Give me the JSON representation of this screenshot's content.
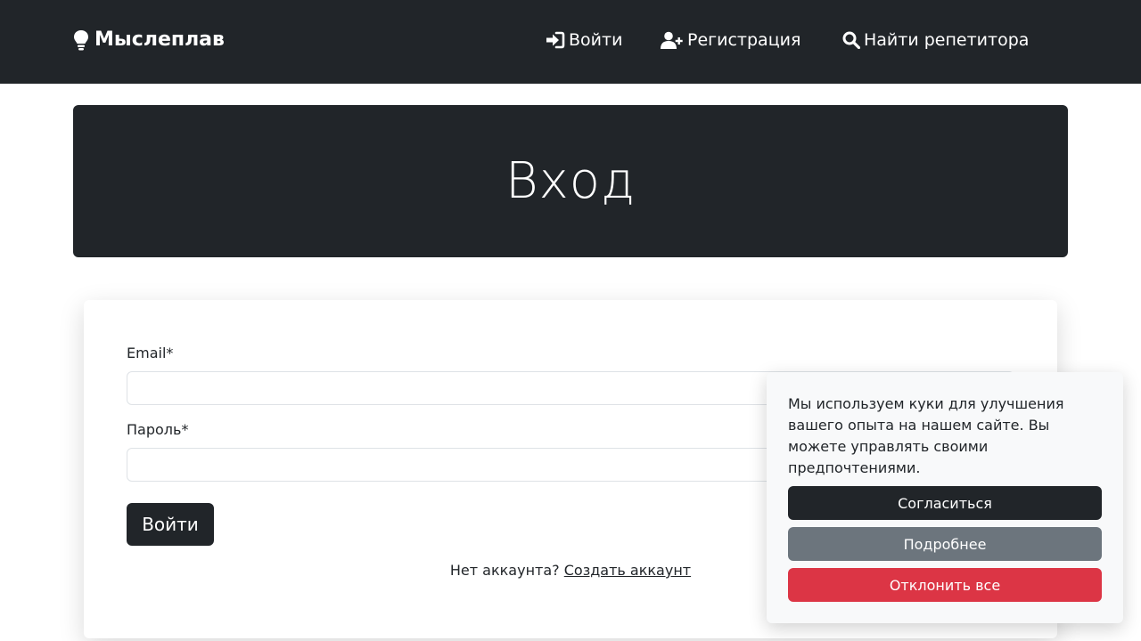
{
  "navbar": {
    "brand": "Мыслеплав",
    "brand_icon": "lightbulb-icon",
    "links": [
      {
        "label": "Войти",
        "icon": "sign-in-icon"
      },
      {
        "label": "Регистрация",
        "icon": "user-plus-icon"
      },
      {
        "label": "Найти репетитора",
        "icon": "search-icon"
      }
    ]
  },
  "hero": {
    "title": "Вход"
  },
  "login_form": {
    "email_label": "Email*",
    "email_value": "",
    "password_label": "Пароль*",
    "password_value": "",
    "submit_label": "Войти",
    "no_account_text": "Нет аккаунта?",
    "create_account_link": "Создать аккаунт"
  },
  "cookie_banner": {
    "text": "Мы используем куки для улучшения вашего опыта на нашем сайте. Вы можете управлять своими предпочтениями.",
    "accept_label": "Согласиться",
    "more_label": "Подробнее",
    "decline_label": "Отклонить все"
  },
  "colors": {
    "dark": "#212529",
    "secondary": "#6c757d",
    "danger": "#dc3545",
    "light": "#f8f9fa"
  }
}
